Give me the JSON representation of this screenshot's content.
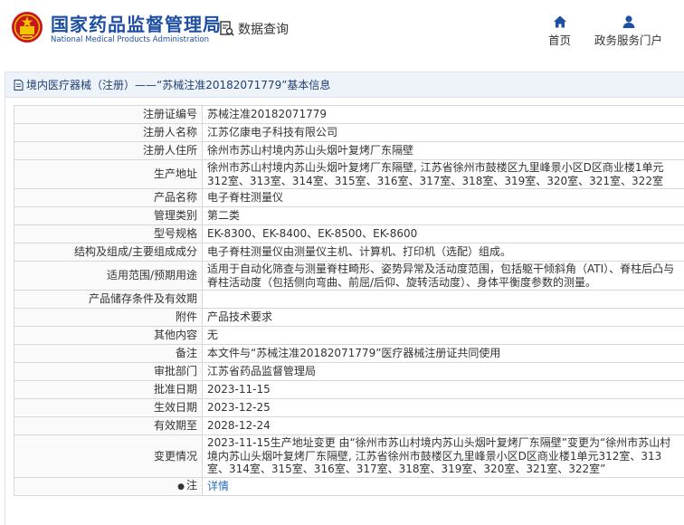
{
  "header": {
    "brand_cn": "国家药品监督管理局",
    "brand_en": "National Medical Products Administration",
    "query_label": "数据查询",
    "nav": [
      {
        "label": "首页",
        "icon": "home-icon"
      },
      {
        "label": "政务服务门户",
        "icon": "user-icon"
      }
    ]
  },
  "panel": {
    "title": "境内医疗器械（注册）——“苏械注准20182071779”基本信息"
  },
  "rows": [
    {
      "key": "注册证编号",
      "value": "苏械注准20182071779"
    },
    {
      "key": "注册人名称",
      "value": "江苏亿康电子科技有限公司"
    },
    {
      "key": "注册人住所",
      "value": "徐州市苏山村境内苏山头烟叶复烤厂东隔壁"
    },
    {
      "key": "生产地址",
      "value": "徐州市苏山村境内苏山头烟叶复烤厂东隔壁, 江苏省徐州市鼓楼区九里峰景小区D区商业楼1单元312室、313室、314室、315室、316室、317室、318室、319室、320室、321室、322室"
    },
    {
      "key": "产品名称",
      "value": "电子脊柱测量仪"
    },
    {
      "key": "管理类别",
      "value": "第二类"
    },
    {
      "key": "型号规格",
      "value": "EK-8300、EK-8400、EK-8500、EK-8600"
    },
    {
      "key": "结构及组成/主要组成成分",
      "value": "电子脊柱测量仪由测量仪主机、计算机、打印机（选配）组成。"
    },
    {
      "key": "适用范围/预期用途",
      "value": "适用于自动化筛查与测量脊柱畸形、姿势异常及活动度范围，包括躯干倾斜角（ATI）、脊柱后凸与脊柱活动度（包括侧向弯曲、前屈/后仰、旋转活动度）、身体平衡度参数的测量。"
    },
    {
      "key": "产品储存条件及有效期",
      "value": ""
    },
    {
      "key": "附件",
      "value": "产品技术要求"
    },
    {
      "key": "其他内容",
      "value": "无"
    },
    {
      "key": "备注",
      "value": "本文件与“苏械注准20182071779”医疗器械注册证共同使用"
    },
    {
      "key": "审批部门",
      "value": "江苏省药品监督管理局"
    },
    {
      "key": "批准日期",
      "value": "2023-11-15"
    },
    {
      "key": "生效日期",
      "value": "2023-12-25"
    },
    {
      "key": "有效期至",
      "value": "2028-12-24"
    },
    {
      "key": "变更情况",
      "value": "2023-11-15生产地址变更 由“徐州市苏山村境内苏山头烟叶复烤厂东隔壁”变更为“徐州市苏山村境内苏山头烟叶复烤厂东隔壁, 江苏省徐州市鼓楼区九里峰景小区D区商业楼1单元312室、313室、314室、315室、316室、317室、318室、319室、320室、321室、322室”"
    },
    {
      "key": "注",
      "value": "详情",
      "link": true
    }
  ],
  "colors": {
    "brand": "#1e4fa3",
    "title_bg": "#eef3f9",
    "link": "#2a6ebb",
    "emblem_red": "#c8161d",
    "emblem_gold": "#f4c400"
  }
}
